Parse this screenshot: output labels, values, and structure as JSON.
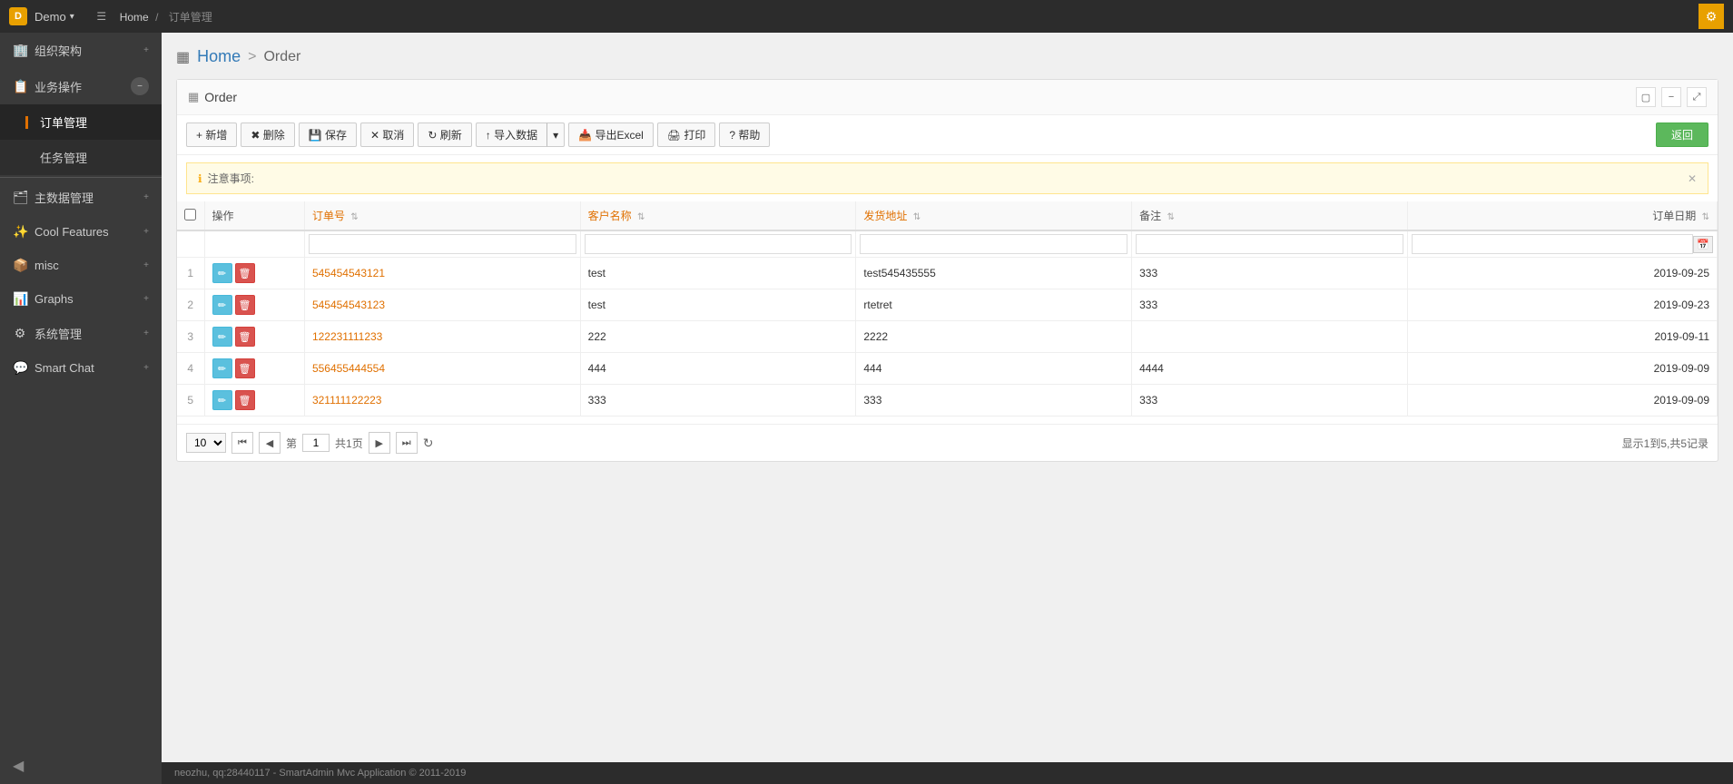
{
  "app": {
    "name": "Demo",
    "logo_char": "D"
  },
  "header": {
    "breadcrumb_home": "Home",
    "breadcrumb_separator": "/",
    "breadcrumb_current": "订单管理",
    "top_right_icon": "⚙"
  },
  "sidebar": {
    "items": [
      {
        "id": "org",
        "icon": "🏢",
        "label": "组织架构",
        "has_expand": true
      },
      {
        "id": "biz",
        "icon": "📋",
        "label": "业务操作",
        "has_expand": true,
        "expanded": true
      },
      {
        "id": "order",
        "icon": "",
        "label": "订单管理",
        "is_sub": true,
        "is_active": true
      },
      {
        "id": "task",
        "icon": "",
        "label": "任务管理",
        "is_sub": true
      },
      {
        "id": "master",
        "icon": "🗂",
        "label": "主数据管理",
        "has_expand": true
      },
      {
        "id": "cool",
        "icon": "✨",
        "label": "Cool Features",
        "has_expand": true
      },
      {
        "id": "misc",
        "icon": "📦",
        "label": "misc",
        "has_expand": true
      },
      {
        "id": "graphs",
        "icon": "📊",
        "label": "Graphs",
        "has_expand": true
      },
      {
        "id": "sysadmin",
        "icon": "⚙",
        "label": "系统管理",
        "has_expand": true
      },
      {
        "id": "chat",
        "icon": "💬",
        "label": "Smart Chat",
        "has_expand": true
      }
    ],
    "bottom_icon": "◀"
  },
  "page": {
    "grid_icon": "▦",
    "home_label": "Home",
    "separator": ">",
    "order_label": "Order"
  },
  "card": {
    "title": "Order",
    "icon_square": "▢",
    "icon_minus": "−",
    "icon_expand": "⤢"
  },
  "toolbar": {
    "add": "+ 新增",
    "delete": "✖ 删除",
    "save": "💾 保存",
    "cancel": "✕ 取消",
    "refresh": "↻ 刷新",
    "import": "↑ 导入数据",
    "import_dropdown": "▾",
    "export_excel": "📥 导出Excel",
    "print": "🖨 打印",
    "help": "? 帮助",
    "return": "返回"
  },
  "notice": {
    "icon": "ℹ",
    "text": "注意事项:"
  },
  "table": {
    "columns": [
      {
        "key": "checkbox",
        "label": ""
      },
      {
        "key": "action",
        "label": "操作"
      },
      {
        "key": "order_no",
        "label": "订单号",
        "sortable": true,
        "orange": true
      },
      {
        "key": "customer",
        "label": "客户名称",
        "sortable": true,
        "orange": true
      },
      {
        "key": "address",
        "label": "发货地址",
        "sortable": true,
        "orange": true
      },
      {
        "key": "remark",
        "label": "备注",
        "sortable": true
      },
      {
        "key": "order_date",
        "label": "订单日期",
        "sortable": true
      }
    ],
    "rows": [
      {
        "num": "1",
        "order_no": "545454543121",
        "customer": "test",
        "address": "test545435555",
        "remark": "333",
        "order_date": "2019-09-25"
      },
      {
        "num": "2",
        "order_no": "545454543123",
        "customer": "test",
        "address": "rtetret",
        "remark": "333",
        "order_date": "2019-09-23"
      },
      {
        "num": "3",
        "order_no": "122231111233",
        "customer": "222",
        "address": "2222",
        "remark": "",
        "order_date": "2019-09-11"
      },
      {
        "num": "4",
        "order_no": "556455444554",
        "customer": "444",
        "address": "444",
        "remark": "4444",
        "order_date": "2019-09-09"
      },
      {
        "num": "5",
        "order_no": "321111122223",
        "customer": "333",
        "address": "333",
        "remark": "333",
        "order_date": "2019-09-09"
      }
    ]
  },
  "pagination": {
    "page_size": "10",
    "page_size_suffix": "▾",
    "current_page": "1",
    "total_pages": "1",
    "page_label": "第",
    "total_label": "共",
    "page_unit": "页",
    "total_info": "显示1到5,共5记录"
  },
  "footer": {
    "text": "neozhu, qq:28440117 - SmartAdmin Mvc Application © 2011-2019"
  }
}
